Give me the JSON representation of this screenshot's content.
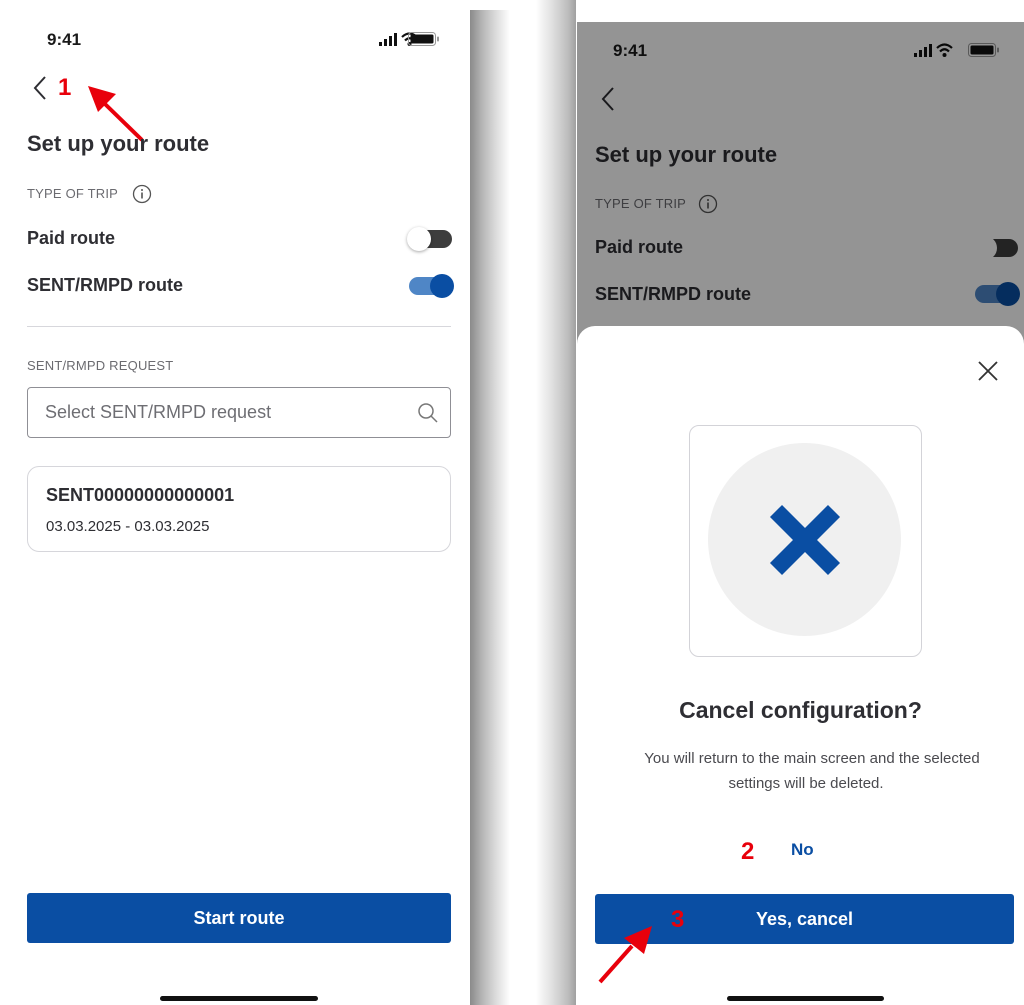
{
  "left": {
    "status_time": "9:41",
    "title": "Set up your route",
    "type_of_trip_label": "TYPE OF TRIP",
    "paid_route_label": "Paid route",
    "sent_route_label": "SENT/RMPD route",
    "request_label": "SENT/RMPD REQUEST",
    "search_placeholder": "Select SENT/RMPD request",
    "card_title": "SENT00000000000001",
    "card_dates": "03.03.2025 - 03.03.2025",
    "start_button": "Start route",
    "annotation_1": "1",
    "paid_route_on": false,
    "sent_route_on": true
  },
  "right": {
    "status_time": "9:41",
    "title": "Set up your route",
    "type_of_trip_label": "TYPE OF TRIP",
    "paid_route_label": "Paid route",
    "sent_route_label": "SENT/RMPD route",
    "dialog_title": "Cancel configuration?",
    "dialog_message_line1": "You will return to the main screen and the selected",
    "dialog_message_line2": "settings will be deleted.",
    "no_button": "No",
    "yes_button": "Yes, cancel",
    "annotation_2": "2",
    "annotation_3": "3"
  },
  "colors": {
    "accent": "#0a4ea3",
    "annotation_red": "#e8000b",
    "text_dark": "#2e2e33"
  },
  "icons": [
    "back-chevron-icon",
    "info-icon",
    "search-icon",
    "close-icon",
    "cancel-x-icon",
    "signal-icon",
    "wifi-icon",
    "battery-icon",
    "annotation-arrow-icon"
  ]
}
